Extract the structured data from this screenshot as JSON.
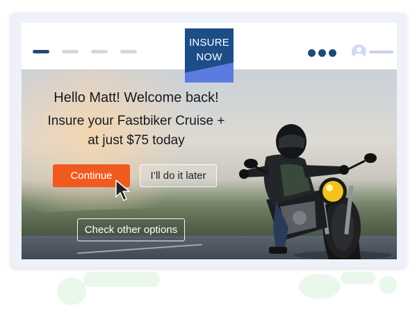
{
  "header": {
    "logo_text": "INSURE\nNOW",
    "nav_items_count": 4,
    "dots_count": 3
  },
  "hero": {
    "greeting": "Hello Matt! Welcome back!",
    "offer_line1": "Insure your Fastbiker Cruise +",
    "offer_line2": "at just $75 today"
  },
  "buttons": {
    "continue": "Continue",
    "later": "I’ll do it later",
    "other": "Check other options"
  },
  "colors": {
    "brand_blue": "#1c4d86",
    "accent_orange": "#f05a1e",
    "logo_stripe": "#5b7be0"
  },
  "icons": [
    "user-avatar-icon",
    "more-dots-icon",
    "mouse-pointer-icon"
  ]
}
